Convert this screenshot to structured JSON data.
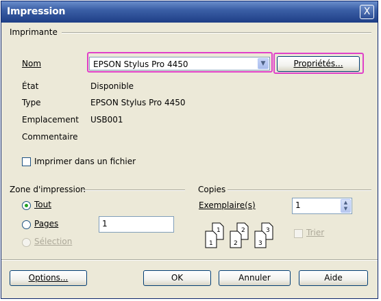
{
  "dialog": {
    "title": "Impression",
    "close_glyph": "X"
  },
  "printer": {
    "group_label": "Imprimante",
    "name_label": "Nom",
    "name_value": "EPSON Stylus Pro 4450",
    "properties_button": "Propriétés...",
    "status_label": "État",
    "status_value": "Disponible",
    "type_label": "Type",
    "type_value": "EPSON Stylus Pro 4450",
    "location_label": "Emplacement",
    "location_value": "USB001",
    "comment_label": "Commentaire",
    "comment_value": "",
    "print_to_file_label": "Imprimer dans un fichier",
    "print_to_file_checked": false
  },
  "print_range": {
    "group_label": "Zone d'impression",
    "all_label": "Tout",
    "pages_label": "Pages",
    "pages_value": "1",
    "selection_label": "Sélection",
    "selected": "all"
  },
  "copies": {
    "group_label": "Copies",
    "count_label": "Exemplaire(s)",
    "count_value": "1",
    "collate_label": "Trier",
    "collate_checked": false,
    "stack_labels": [
      [
        "1",
        "1"
      ],
      [
        "2",
        "2"
      ],
      [
        "3",
        "3"
      ]
    ]
  },
  "footer": {
    "options_button": "Options...",
    "ok_button": "OK",
    "cancel_button": "Annuler",
    "help_button": "Aide"
  },
  "colors": {
    "titlebar": "#1E3E86",
    "dialog_bg": "#ECE9D8",
    "highlight": "#E040C8"
  }
}
